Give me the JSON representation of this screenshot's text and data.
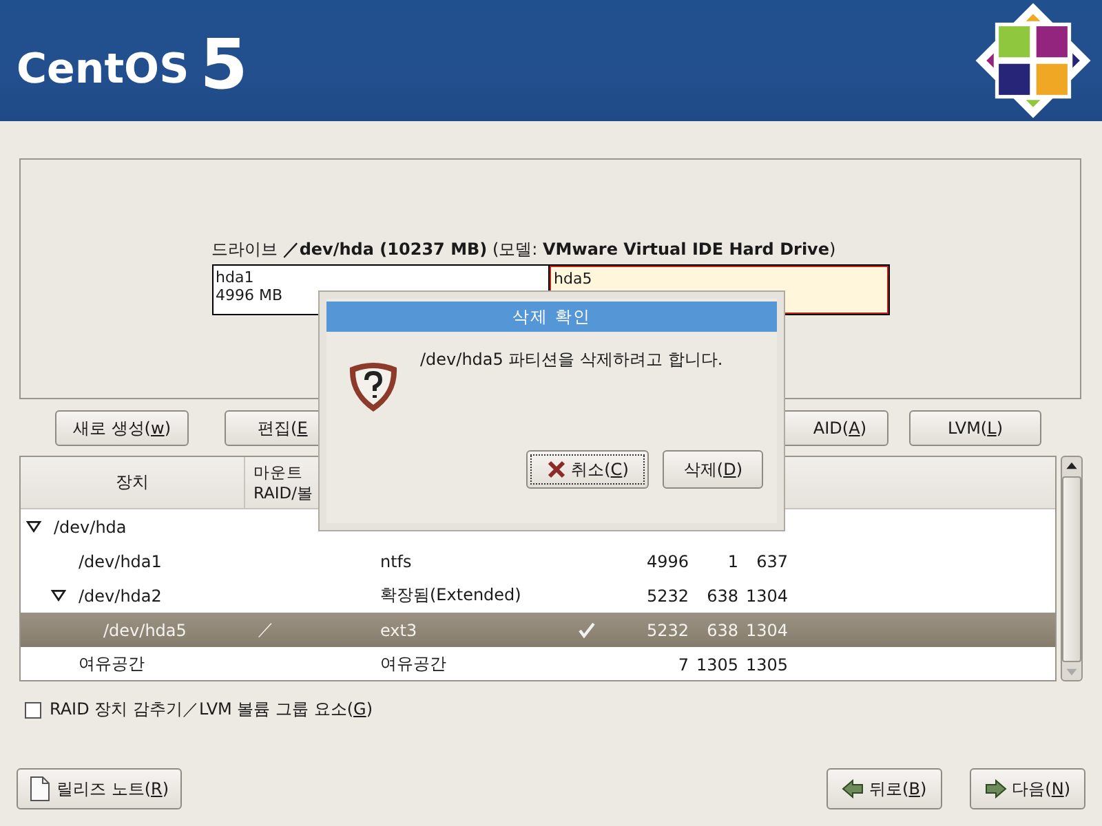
{
  "banner": {
    "logo_text": "CentOS",
    "logo_version": "5"
  },
  "drive": {
    "label": "드라이브 **／dev/hda (10237 MB)** (모델: **VMware Virtual IDE Hard Drive**)",
    "partitions": [
      {
        "name": "hda1",
        "size": "4996 MB",
        "selected": false
      },
      {
        "name": "hda5",
        "selected": true
      }
    ]
  },
  "actions": [
    {
      "pre": "새로 생성(",
      "key": "w",
      "post": ")"
    },
    {
      "pre": "편집(",
      "key": "E"
    },
    {
      "pre": "AID(",
      "key": "A",
      "post": ")"
    },
    {
      "pre": "LVM(",
      "key": "L",
      "post": ")"
    }
  ],
  "table": {
    "columns": [
      {
        "lines": [
          "장치"
        ]
      },
      {
        "lines": [
          "마운트",
          "RAID/볼"
        ]
      }
    ],
    "rows": [
      {
        "device": "/dev/hda",
        "expanded": true,
        "selected": false,
        "children": [
          {
            "device": "/dev/hda1",
            "type": "ntfs",
            "format": false,
            "size": "4996",
            "start": "1",
            "end": "637",
            "selected": false
          },
          {
            "device": "/dev/hda2",
            "type": "확장됨(Extended)",
            "format": false,
            "size": "5232",
            "start": "638",
            "end": "1304",
            "selected": false,
            "expanded": true,
            "children": [
              {
                "device": "/dev/hda5",
                "mount": "／",
                "type": "ext3",
                "format": true,
                "size": "5232",
                "start": "638",
                "end": "1304",
                "selected": true
              }
            ]
          },
          {
            "device": "여유공간",
            "type": "여유공간",
            "format": false,
            "size": "7",
            "start": "1305",
            "end": "1305",
            "selected": false
          }
        ]
      }
    ]
  },
  "hide_raid": {
    "pre": "RAID 장치 감추기／LVM 볼륨 그룹 요소(",
    "key": "G",
    "post": ")",
    "checked": false
  },
  "footer": {
    "left": {
      "pre": "릴리즈 노트(",
      "key": "R",
      "post": ")"
    },
    "right": [
      {
        "kind": "back",
        "pre": "뒤로(",
        "key": "B",
        "post": ")"
      },
      {
        "kind": "next",
        "pre": "다음(",
        "key": "N",
        "post": ")"
      }
    ]
  },
  "dialog": {
    "title": "삭제 확인",
    "message": "/dev/hda5 파티션을 삭제하려고 합니다.",
    "buttons": [
      {
        "kind": "cancel",
        "pre": "취소(",
        "key": "C",
        "post": ")",
        "focused": true
      },
      {
        "kind": "delete",
        "pre": "삭제(",
        "key": "D",
        "post": ")",
        "focused": false
      }
    ]
  }
}
